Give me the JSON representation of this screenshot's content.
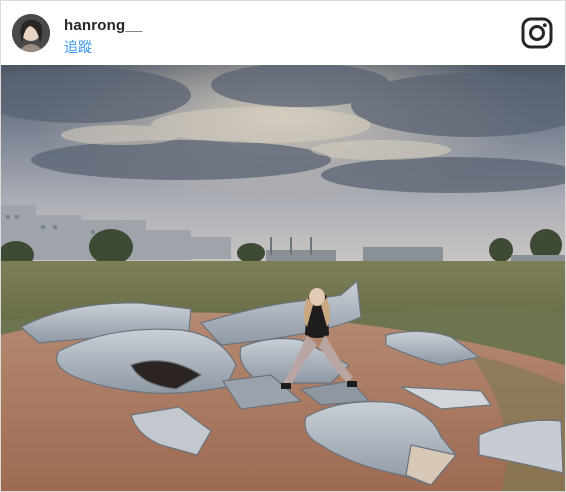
{
  "post": {
    "username": "hanrong__",
    "follow_label": "追蹤"
  },
  "icons": {
    "avatar": "user-avatar-photo",
    "brand": "instagram-icon"
  },
  "photo": {
    "subject": "person-sitting-among-broken-shark-sculpture-pieces"
  },
  "colors": {
    "follow_link": "#3897f0",
    "username_text": "#262626",
    "border": "#dbdbdb"
  }
}
